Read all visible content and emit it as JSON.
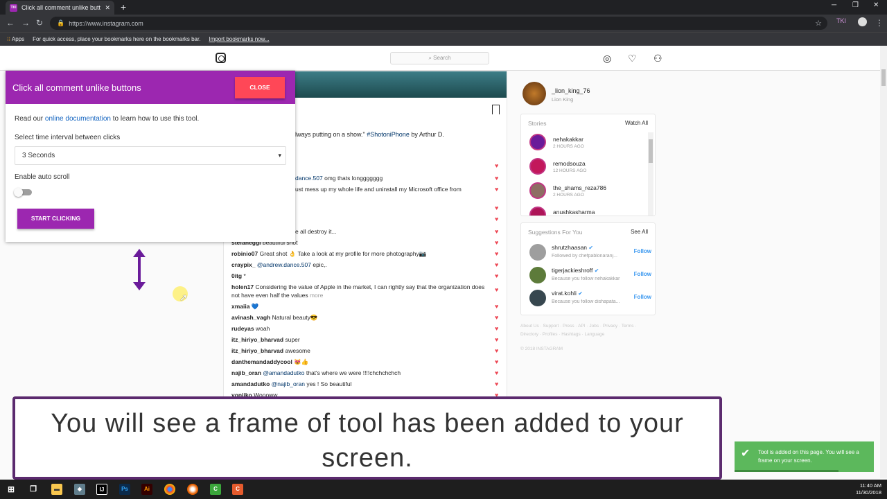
{
  "browser": {
    "tab_title": "Click all comment unlike buttons",
    "tab_favicon": "TKI",
    "new_tab": "+",
    "url": "https://www.instagram.com",
    "bookmarks_apps": "Apps",
    "bookmarks_hint": "For quick access, place your bookmarks here on the bookmarks bar.",
    "bookmarks_import": "Import bookmarks now..."
  },
  "instagram": {
    "search_placeholder": "Search",
    "caption": "lways putting on a show.\" ",
    "caption_tag": "#ShotoniPhone",
    "caption_by": " by Arthur D.",
    "comments": [
      {
        "user": "",
        "mention": "dance.507",
        "text": " omg thats longgggggg"
      },
      {
        "user": "",
        "mention": "",
        "text": "ust mess up my whole life and uninstall my Microsoft office from"
      },
      {
        "user": "",
        "mention": "",
        "text": "e all destroy it..."
      },
      {
        "user": "stefaneggi",
        "mention": "",
        "text": " beautiful shot"
      },
      {
        "user": "robinio07",
        "mention": "",
        "text": " Great shot 👌 Take a look at my profile for more photography📷"
      },
      {
        "user": "craypix_",
        "mention": "@andrew.dance.507",
        "text": " epic,."
      },
      {
        "user": "0itg",
        "mention": "",
        "text": " *"
      },
      {
        "user": "holen17",
        "mention": "",
        "text": " Considering the value of Apple in the market, I can rightly say that the organization does not have even half the values ",
        "more": "more"
      },
      {
        "user": "xmaiia",
        "mention": "",
        "text": " 💙"
      },
      {
        "user": "avinash_vagh",
        "mention": "",
        "text": " Natural beauty😎"
      },
      {
        "user": "rudeyas",
        "mention": "",
        "text": " woah"
      },
      {
        "user": "itz_hiriyo_bharvad",
        "mention": "",
        "text": " super"
      },
      {
        "user": "itz_hiriyo_bharvad",
        "mention": "",
        "text": " awesome"
      },
      {
        "user": "danthemandaddycool",
        "mention": "",
        "text": " 😻👍"
      },
      {
        "user": "najib_oran",
        "mention": "@amandadutko",
        "text": " that's where we were !!!!chchchchch"
      },
      {
        "user": "amandadutko",
        "mention": "@najib_oran",
        "text": " yes ! So beautiful"
      },
      {
        "user": "yoniiko",
        "mention": "",
        "text": " Woooww"
      }
    ],
    "profile": {
      "username": "_lion_king_76",
      "name": "Lion King"
    },
    "stories": {
      "heading": "Stories",
      "action": "Watch All",
      "items": [
        {
          "name": "nehakakkar",
          "time": "2 HOURS AGO"
        },
        {
          "name": "remodsouza",
          "time": "12 HOURS AGO"
        },
        {
          "name": "the_shams_reza786",
          "time": "2 HOURS AGO"
        },
        {
          "name": "anushkasharma",
          "time": ""
        }
      ]
    },
    "suggestions": {
      "heading": "Suggestions For You",
      "action": "See All",
      "follow": "Follow",
      "items": [
        {
          "name": "shrutzhaasan",
          "sub": "Followed by chefpablonaranj..."
        },
        {
          "name": "tigerjackieshroff",
          "sub": "Because you follow nehakakkar"
        },
        {
          "name": "virat.kohli",
          "sub": "Because you follow dishapata..."
        }
      ]
    },
    "footer_links": "About Us · Support · Press · API · Jobs · Privacy · Terms · Directory · Profiles · Hashtags · Language",
    "copyright": "© 2018 INSTAGRAM"
  },
  "tool": {
    "title": "Click all comment unlike buttons",
    "close": "CLOSE",
    "doc_prefix": "Read our ",
    "doc_link": "online documentation",
    "doc_suffix": " to learn how to use this tool.",
    "interval_label": "Select time interval between clicks",
    "interval_value": "3 Seconds",
    "autoscroll_label": "Enable auto scroll",
    "autoscroll_on": false,
    "start": "START CLICKING"
  },
  "video_caption": "You will see a frame of tool has been added to your screen.",
  "toast": "Tool is added on this page. You will see a frame on your screen.",
  "taskbar": {
    "time": "11:40 AM",
    "date": "11/30/2018"
  },
  "colors": {
    "tool_purple": "#9c27b0",
    "close_red": "#ff4757",
    "toast_green": "#5cb85c",
    "heart": "#ed4956"
  }
}
